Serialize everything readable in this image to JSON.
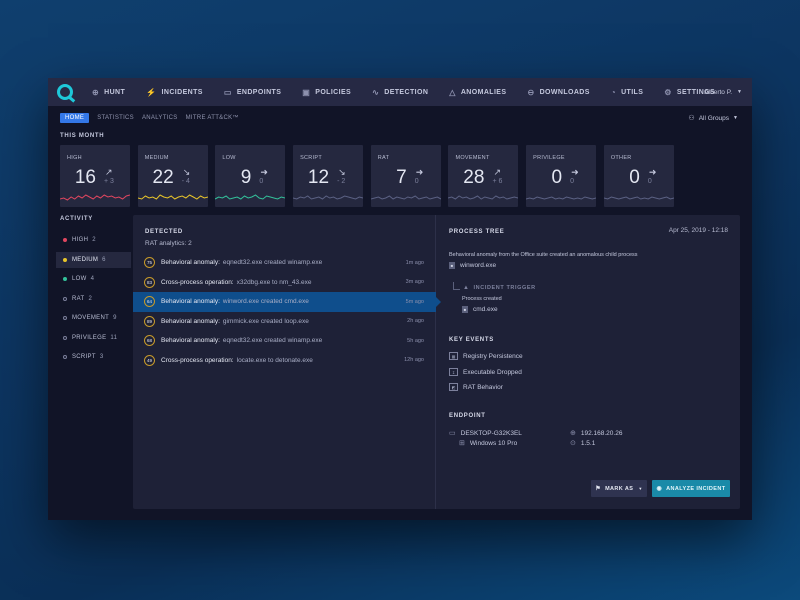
{
  "nav": {
    "items": [
      {
        "label": "HUNT",
        "icon": "⊕",
        "icon_name": "crosshair-icon"
      },
      {
        "label": "INCIDENTS",
        "icon": "⚡",
        "icon_name": "bolt-icon"
      },
      {
        "label": "ENDPOINTS",
        "icon": "▭",
        "icon_name": "monitor-icon"
      },
      {
        "label": "POLICIES",
        "icon": "▣",
        "icon_name": "policy-icon"
      },
      {
        "label": "DETECTION",
        "icon": "∿",
        "icon_name": "pulse-icon"
      },
      {
        "label": "ANOMALIES",
        "icon": "△",
        "icon_name": "warning-icon"
      },
      {
        "label": "DOWNLOADS",
        "icon": "⊖",
        "icon_name": "download-icon"
      },
      {
        "label": "UTILS",
        "icon": "◔",
        "icon_name": "utils-icon"
      },
      {
        "label": "SETTINGS",
        "icon": "⚙",
        "icon_name": "gear-icon"
      }
    ],
    "user": "Alberto P."
  },
  "subnav": {
    "tabs": [
      "HOME",
      "STATISTICS",
      "ANALYTICS",
      "MITRE ATT&CK™"
    ],
    "groups": "All Groups"
  },
  "this_month": {
    "label": "THIS MONTH",
    "cards": [
      {
        "label": "HIGH",
        "value": "16",
        "arrow": "↗",
        "delta": "+ 3",
        "color": "#e0465f"
      },
      {
        "label": "MEDIUM",
        "value": "22",
        "arrow": "↘",
        "delta": "- 4",
        "color": "#e8c52a"
      },
      {
        "label": "LOW",
        "value": "9",
        "arrow": "➜",
        "delta": "0",
        "color": "#33c19a"
      },
      {
        "label": "SCRIPT",
        "value": "12",
        "arrow": "↘",
        "delta": "- 2",
        "color": "#5b6183"
      },
      {
        "label": "RAT",
        "value": "7",
        "arrow": "➜",
        "delta": "0",
        "color": "#5b6183"
      },
      {
        "label": "MOVEMENT",
        "value": "28",
        "arrow": "↗",
        "delta": "+ 6",
        "color": "#5b6183"
      },
      {
        "label": "PRIVILEGE",
        "value": "0",
        "arrow": "➜",
        "delta": "0",
        "color": "#5b6183"
      },
      {
        "label": "OTHER",
        "value": "0",
        "arrow": "➜",
        "delta": "0",
        "color": "#5b6183"
      }
    ]
  },
  "activity": {
    "label": "ACTIVITY",
    "items": [
      {
        "label": "HIGH",
        "count": "2",
        "color": "#e0465f",
        "filled": true
      },
      {
        "label": "MEDIUM",
        "count": "6",
        "color": "#e8c52a",
        "filled": true
      },
      {
        "label": "LOW",
        "count": "4",
        "color": "#33c19a",
        "filled": true
      },
      {
        "label": "RAT",
        "count": "2",
        "color": "#7c809c",
        "filled": false
      },
      {
        "label": "MOVEMENT",
        "count": "9",
        "color": "#7c809c",
        "filled": false
      },
      {
        "label": "PRIVILEGE",
        "count": "11",
        "color": "#7c809c",
        "filled": false
      },
      {
        "label": "SCRIPT",
        "count": "3",
        "color": "#7c809c",
        "filled": false
      }
    ]
  },
  "detected": {
    "title": "DETECTED",
    "subtitle": "RAT analytics: 2",
    "rows": [
      {
        "score": "75",
        "type": "Behavioral anomaly:",
        "detail": "eqnedt32.exe created winamp.exe",
        "time": "1m  ago"
      },
      {
        "score": "83",
        "type": "Cross-process operation:",
        "detail": "x32dbg.exe to nm_43.exe",
        "time": "3m  ago"
      },
      {
        "score": "64",
        "type": "Behavioral anomaly:",
        "detail": "winword.exe created cmd.exe",
        "time": "5m ago"
      },
      {
        "score": "89",
        "type": "Behavioral anomaly:",
        "detail": "gimmick.exe created loop.exe",
        "time": "2h ago"
      },
      {
        "score": "68",
        "type": "Behavioral anomaly:",
        "detail": "eqnedt32.exe created winamp.exe",
        "time": "5h  ago"
      },
      {
        "score": "49",
        "type": "Cross-process operation:",
        "detail": "locate.exe to detonate.exe",
        "time": "12h ago"
      }
    ]
  },
  "process_tree": {
    "title": "PROCESS TREE",
    "date": "Apr 25, 2019 - 12:18",
    "description": "Behavioral anomaly from the Office suite created an anomalous child process",
    "parent": "winword.exe",
    "trigger_label": "INCIDENT TRIGGER",
    "process_created": "Process created",
    "child": "cmd.exe"
  },
  "key_events": {
    "title": "KEY EVENTS",
    "items": [
      "Registry Persistence",
      "Executable Dropped",
      "RAT Behavior"
    ]
  },
  "endpoint": {
    "title": "ENDPOINT",
    "hostname": "DESKTOP-G32K3EL",
    "os": "Windows 10 Pro",
    "ip": "192.168.20.26",
    "version": "1.5.1"
  },
  "actions": {
    "mark_as": "MARK AS",
    "analyze": "ANALYZE INCIDENT"
  }
}
